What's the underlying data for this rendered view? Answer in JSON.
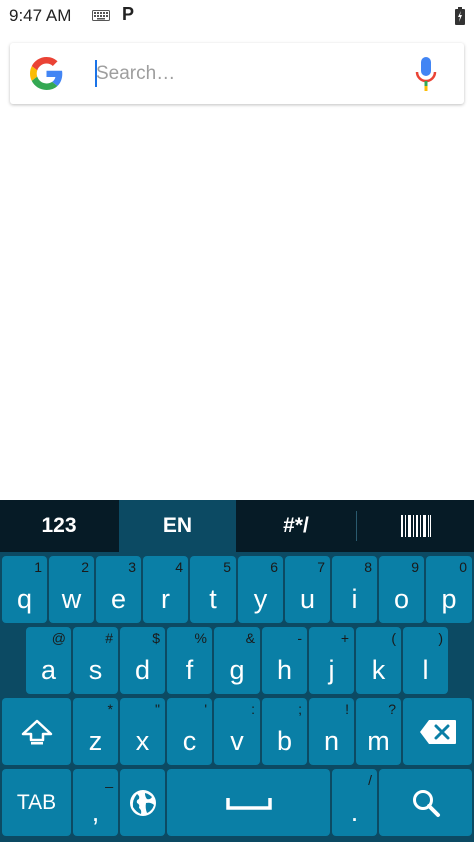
{
  "status_bar": {
    "time": "9:47 AM",
    "notification_letter": "P",
    "icons": [
      "keyboard-icon",
      "parking-icon",
      "battery-icon"
    ]
  },
  "search": {
    "placeholder": "Search…",
    "value": "",
    "icons": [
      "google-g-icon",
      "microphone-icon"
    ]
  },
  "keyboard": {
    "toolbar": {
      "tabs": [
        {
          "label": "123"
        },
        {
          "label": "EN"
        },
        {
          "label": "#*/"
        }
      ],
      "barcode_icon": "barcode-icon"
    },
    "row1": [
      {
        "main": "q",
        "hint": "1"
      },
      {
        "main": "w",
        "hint": "2"
      },
      {
        "main": "e",
        "hint": "3"
      },
      {
        "main": "r",
        "hint": "4"
      },
      {
        "main": "t",
        "hint": "5"
      },
      {
        "main": "y",
        "hint": "6"
      },
      {
        "main": "u",
        "hint": "7"
      },
      {
        "main": "i",
        "hint": "8"
      },
      {
        "main": "o",
        "hint": "9"
      },
      {
        "main": "p",
        "hint": "0"
      }
    ],
    "row2": [
      {
        "main": "a",
        "hint": "@"
      },
      {
        "main": "s",
        "hint": "#"
      },
      {
        "main": "d",
        "hint": "$"
      },
      {
        "main": "f",
        "hint": "%"
      },
      {
        "main": "g",
        "hint": "&"
      },
      {
        "main": "h",
        "hint": "-"
      },
      {
        "main": "j",
        "hint": "+"
      },
      {
        "main": "k",
        "hint": "("
      },
      {
        "main": "l",
        "hint": ")"
      }
    ],
    "row3": [
      {
        "main": "z",
        "hint": "*"
      },
      {
        "main": "x",
        "hint": "\""
      },
      {
        "main": "c",
        "hint": "'"
      },
      {
        "main": "v",
        "hint": ":"
      },
      {
        "main": "b",
        "hint": ";"
      },
      {
        "main": "n",
        "hint": "!"
      },
      {
        "main": "m",
        "hint": "?"
      }
    ],
    "row4": {
      "tab_label": "TAB",
      "comma": {
        "main": ",",
        "hint": "_"
      },
      "period": {
        "main": ".",
        "hint": "/"
      }
    },
    "icons": [
      "shift-icon",
      "backspace-icon",
      "globe-icon",
      "space-icon",
      "search-icon"
    ],
    "colors": {
      "toolbar_bg": "#061b26",
      "keyboard_bg": "#0c4a63",
      "key_bg": "#0a7fa6",
      "key_text": "#ffffff",
      "hint_text": "#1a1a1a"
    }
  }
}
